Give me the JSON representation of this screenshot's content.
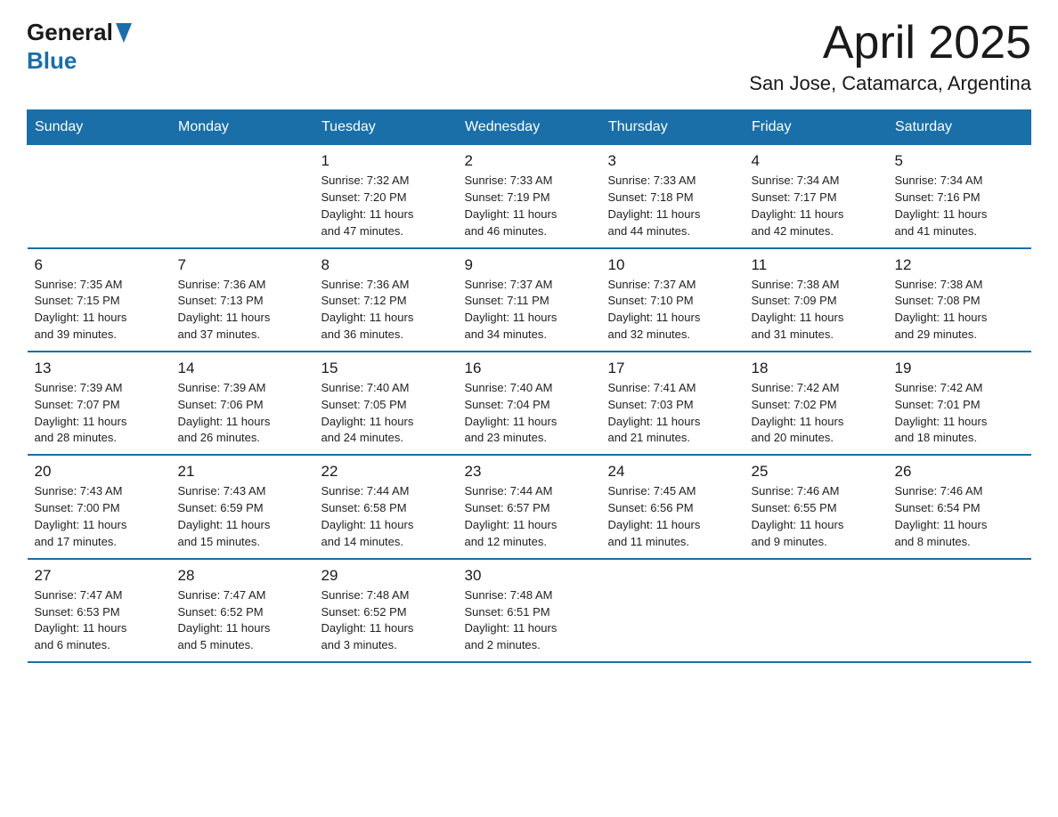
{
  "header": {
    "logo_general": "General",
    "logo_blue": "Blue",
    "month_title": "April 2025",
    "location": "San Jose, Catamarca, Argentina"
  },
  "weekdays": [
    "Sunday",
    "Monday",
    "Tuesday",
    "Wednesday",
    "Thursday",
    "Friday",
    "Saturday"
  ],
  "weeks": [
    [
      {
        "day": "",
        "info": ""
      },
      {
        "day": "",
        "info": ""
      },
      {
        "day": "1",
        "info": "Sunrise: 7:32 AM\nSunset: 7:20 PM\nDaylight: 11 hours\nand 47 minutes."
      },
      {
        "day": "2",
        "info": "Sunrise: 7:33 AM\nSunset: 7:19 PM\nDaylight: 11 hours\nand 46 minutes."
      },
      {
        "day": "3",
        "info": "Sunrise: 7:33 AM\nSunset: 7:18 PM\nDaylight: 11 hours\nand 44 minutes."
      },
      {
        "day": "4",
        "info": "Sunrise: 7:34 AM\nSunset: 7:17 PM\nDaylight: 11 hours\nand 42 minutes."
      },
      {
        "day": "5",
        "info": "Sunrise: 7:34 AM\nSunset: 7:16 PM\nDaylight: 11 hours\nand 41 minutes."
      }
    ],
    [
      {
        "day": "6",
        "info": "Sunrise: 7:35 AM\nSunset: 7:15 PM\nDaylight: 11 hours\nand 39 minutes."
      },
      {
        "day": "7",
        "info": "Sunrise: 7:36 AM\nSunset: 7:13 PM\nDaylight: 11 hours\nand 37 minutes."
      },
      {
        "day": "8",
        "info": "Sunrise: 7:36 AM\nSunset: 7:12 PM\nDaylight: 11 hours\nand 36 minutes."
      },
      {
        "day": "9",
        "info": "Sunrise: 7:37 AM\nSunset: 7:11 PM\nDaylight: 11 hours\nand 34 minutes."
      },
      {
        "day": "10",
        "info": "Sunrise: 7:37 AM\nSunset: 7:10 PM\nDaylight: 11 hours\nand 32 minutes."
      },
      {
        "day": "11",
        "info": "Sunrise: 7:38 AM\nSunset: 7:09 PM\nDaylight: 11 hours\nand 31 minutes."
      },
      {
        "day": "12",
        "info": "Sunrise: 7:38 AM\nSunset: 7:08 PM\nDaylight: 11 hours\nand 29 minutes."
      }
    ],
    [
      {
        "day": "13",
        "info": "Sunrise: 7:39 AM\nSunset: 7:07 PM\nDaylight: 11 hours\nand 28 minutes."
      },
      {
        "day": "14",
        "info": "Sunrise: 7:39 AM\nSunset: 7:06 PM\nDaylight: 11 hours\nand 26 minutes."
      },
      {
        "day": "15",
        "info": "Sunrise: 7:40 AM\nSunset: 7:05 PM\nDaylight: 11 hours\nand 24 minutes."
      },
      {
        "day": "16",
        "info": "Sunrise: 7:40 AM\nSunset: 7:04 PM\nDaylight: 11 hours\nand 23 minutes."
      },
      {
        "day": "17",
        "info": "Sunrise: 7:41 AM\nSunset: 7:03 PM\nDaylight: 11 hours\nand 21 minutes."
      },
      {
        "day": "18",
        "info": "Sunrise: 7:42 AM\nSunset: 7:02 PM\nDaylight: 11 hours\nand 20 minutes."
      },
      {
        "day": "19",
        "info": "Sunrise: 7:42 AM\nSunset: 7:01 PM\nDaylight: 11 hours\nand 18 minutes."
      }
    ],
    [
      {
        "day": "20",
        "info": "Sunrise: 7:43 AM\nSunset: 7:00 PM\nDaylight: 11 hours\nand 17 minutes."
      },
      {
        "day": "21",
        "info": "Sunrise: 7:43 AM\nSunset: 6:59 PM\nDaylight: 11 hours\nand 15 minutes."
      },
      {
        "day": "22",
        "info": "Sunrise: 7:44 AM\nSunset: 6:58 PM\nDaylight: 11 hours\nand 14 minutes."
      },
      {
        "day": "23",
        "info": "Sunrise: 7:44 AM\nSunset: 6:57 PM\nDaylight: 11 hours\nand 12 minutes."
      },
      {
        "day": "24",
        "info": "Sunrise: 7:45 AM\nSunset: 6:56 PM\nDaylight: 11 hours\nand 11 minutes."
      },
      {
        "day": "25",
        "info": "Sunrise: 7:46 AM\nSunset: 6:55 PM\nDaylight: 11 hours\nand 9 minutes."
      },
      {
        "day": "26",
        "info": "Sunrise: 7:46 AM\nSunset: 6:54 PM\nDaylight: 11 hours\nand 8 minutes."
      }
    ],
    [
      {
        "day": "27",
        "info": "Sunrise: 7:47 AM\nSunset: 6:53 PM\nDaylight: 11 hours\nand 6 minutes."
      },
      {
        "day": "28",
        "info": "Sunrise: 7:47 AM\nSunset: 6:52 PM\nDaylight: 11 hours\nand 5 minutes."
      },
      {
        "day": "29",
        "info": "Sunrise: 7:48 AM\nSunset: 6:52 PM\nDaylight: 11 hours\nand 3 minutes."
      },
      {
        "day": "30",
        "info": "Sunrise: 7:48 AM\nSunset: 6:51 PM\nDaylight: 11 hours\nand 2 minutes."
      },
      {
        "day": "",
        "info": ""
      },
      {
        "day": "",
        "info": ""
      },
      {
        "day": "",
        "info": ""
      }
    ]
  ]
}
